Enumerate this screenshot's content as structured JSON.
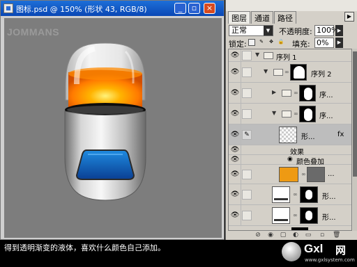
{
  "document": {
    "title": "图标.psd @ 150% (形状 43, RGB/8)",
    "watermark": "JOMMANS",
    "controls": {
      "minimize": "_",
      "restore": "▫",
      "close": "×"
    }
  },
  "layers_panel": {
    "tabs": [
      "图层",
      "通道",
      "路径"
    ],
    "blend_mode": "正常",
    "opacity_label": "不透明度:",
    "opacity_value": "100%",
    "lock_label": "锁定:",
    "fill_label": "填充:",
    "fill_value": "0%",
    "rows": [
      {
        "name": "序列 1"
      },
      {
        "name": "序列 2"
      },
      {
        "name": "序..."
      },
      {
        "name": "序..."
      },
      {
        "name": "形...",
        "fx": "fx"
      },
      {
        "name": "效果"
      },
      {
        "name": "颜色叠加"
      },
      {
        "name": "..."
      },
      {
        "name": "形..."
      },
      {
        "name": "形..."
      }
    ]
  },
  "caption": "得到透明渐变的液体，喜欢什么颜色自己添加。",
  "logo": {
    "brand": "Gxl",
    "cn": "网",
    "url": "www.gxlsystem.com"
  }
}
